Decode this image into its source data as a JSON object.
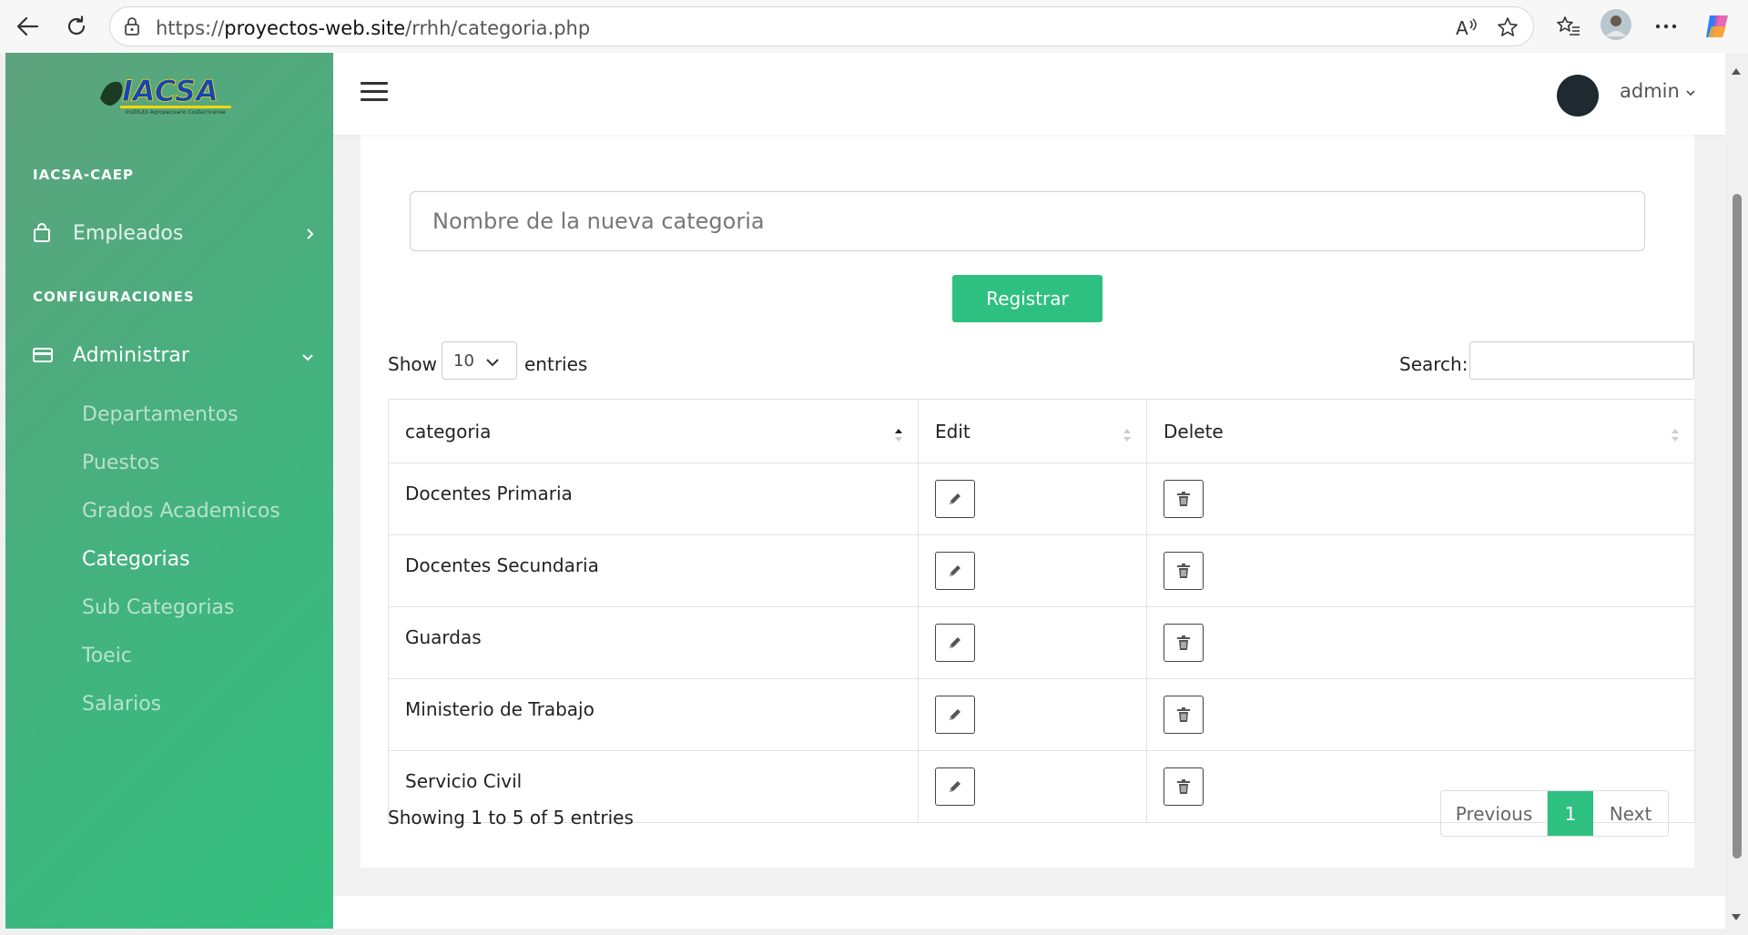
{
  "browser": {
    "url_prefix": "https://",
    "url_host": "proyectos-web.site",
    "url_path": "/rrhh/categoria.php"
  },
  "sidebar": {
    "logo_text": "IACSA",
    "logo_tagline": "Instituto Agropecuario Costarricense",
    "section_main": "IACSA-CAEP",
    "empleados_label": "Empleados",
    "section_config": "CONFIGURACIONES",
    "administrar_label": "Administrar",
    "submenu": [
      {
        "label": "Departamentos"
      },
      {
        "label": "Puestos"
      },
      {
        "label": "Grados Academicos"
      },
      {
        "label": "Categorias"
      },
      {
        "label": "Sub Categorias"
      },
      {
        "label": "Toeic"
      },
      {
        "label": "Salarios"
      }
    ],
    "active_item": "Categorias"
  },
  "topbar": {
    "user_name": "admin"
  },
  "form": {
    "category_placeholder": "Nombre de la nueva categoria",
    "register_label": "Registrar"
  },
  "table_controls": {
    "show_label": "Show",
    "page_length": "10",
    "entries_label": "entries",
    "search_label": "Search:"
  },
  "table": {
    "headers": [
      "categoria",
      "Edit",
      "Delete"
    ],
    "rows": [
      {
        "categoria": "Docentes Primaria"
      },
      {
        "categoria": "Docentes Secundaria"
      },
      {
        "categoria": "Guardas"
      },
      {
        "categoria": "Ministerio de Trabajo"
      },
      {
        "categoria": "Servicio Civil"
      }
    ]
  },
  "pagination": {
    "info": "Showing 1 to 5 of 5 entries",
    "previous": "Previous",
    "current_page": "1",
    "next": "Next"
  },
  "colors": {
    "accent": "#2ec080",
    "sidebar_gradient_start": "#5ea27e",
    "sidebar_gradient_end": "#33c07f"
  }
}
